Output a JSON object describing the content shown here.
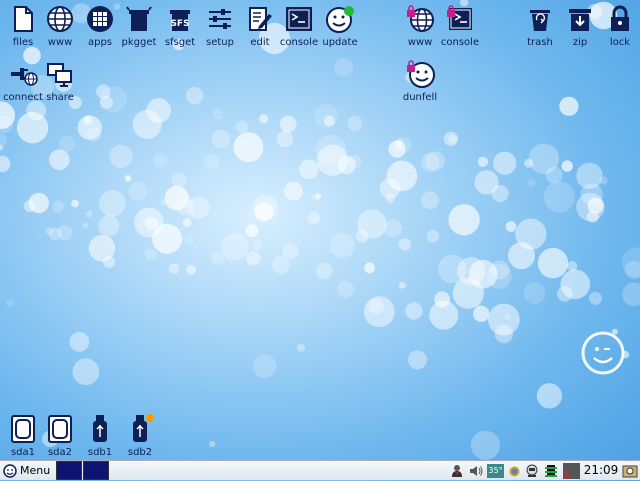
{
  "desktop": {
    "icons_top": [
      {
        "label": "files",
        "icon": "file-icon"
      },
      {
        "label": "www",
        "icon": "globe-icon"
      },
      {
        "label": "apps",
        "icon": "apps-grid-icon"
      },
      {
        "label": "pkgget",
        "icon": "package-box-icon"
      },
      {
        "label": "sfsget",
        "icon": "sfs-box-icon"
      },
      {
        "label": "setup",
        "icon": "sliders-icon"
      },
      {
        "label": "edit",
        "icon": "edit-pencil-icon"
      },
      {
        "label": "console",
        "icon": "terminal-icon"
      },
      {
        "label": "update",
        "icon": "smiley-update-icon"
      },
      {
        "label": "www",
        "icon": "locked-globe-icon"
      },
      {
        "label": "console",
        "icon": "locked-terminal-icon"
      },
      {
        "label": "trash",
        "icon": "trash-icon"
      },
      {
        "label": "zip",
        "icon": "zip-download-icon"
      },
      {
        "label": "lock",
        "icon": "padlock-icon"
      }
    ],
    "icons_row2": [
      {
        "label": "connect",
        "icon": "network-connect-icon"
      },
      {
        "label": "share",
        "icon": "share-monitors-icon"
      },
      {
        "label": "dunfell",
        "icon": "locked-smiley-icon"
      }
    ],
    "drives": [
      {
        "label": "sda1",
        "icon": "drive-icon"
      },
      {
        "label": "sda2",
        "icon": "drive-icon"
      },
      {
        "label": "sdb1",
        "icon": "usb-drive-icon"
      },
      {
        "label": "sdb2",
        "icon": "usb-drive-mounted-icon"
      }
    ]
  },
  "taskbar": {
    "menu_label": "Menu",
    "workspaces": 2,
    "temperature": "35°",
    "clock": "21:09"
  },
  "colors": {
    "icon_navy": "#0d1f57",
    "workspace_active": "#0c1470",
    "update_badge": "#22bb33",
    "mount_badge": "#ff9900"
  }
}
